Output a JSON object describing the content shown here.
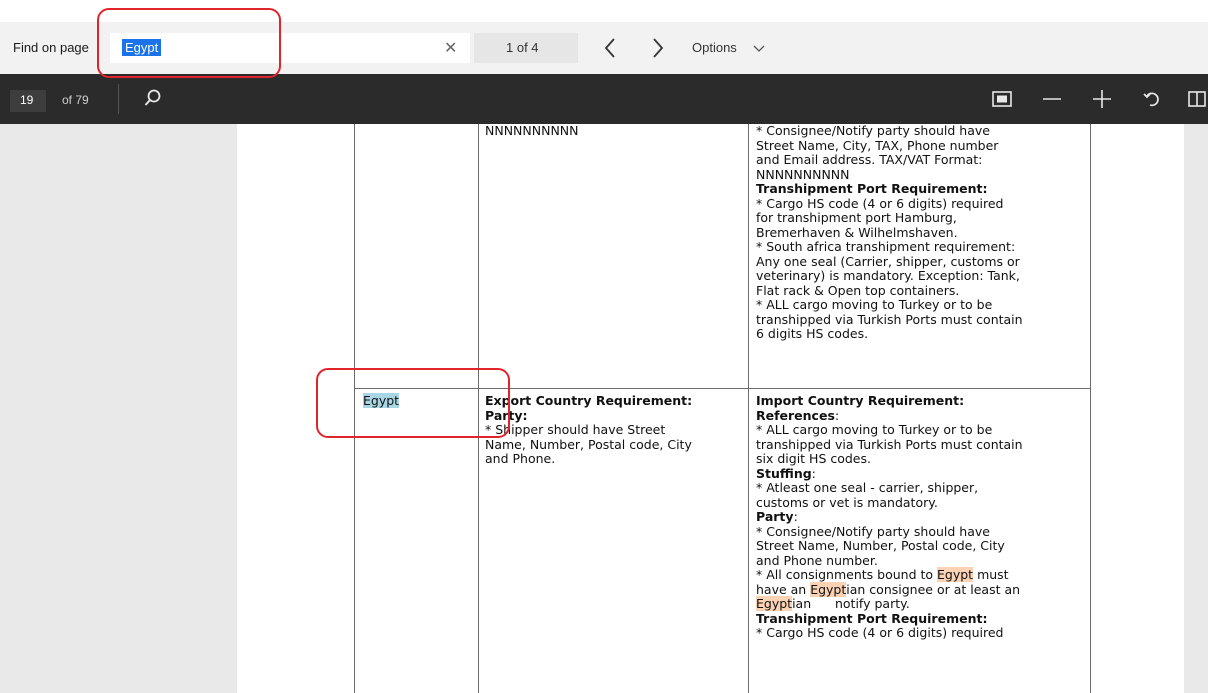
{
  "find_bar": {
    "label": "Find on page",
    "query": "Egypt",
    "clear_icon": "close-icon",
    "match_count": "1 of 4",
    "prev_icon": "chevron-left-icon",
    "next_icon": "chevron-right-icon",
    "options_label": "Options",
    "options_icon": "chevron-down-icon"
  },
  "pdf_toolbar": {
    "page_number": "19",
    "page_total": "of 79",
    "icons": [
      "search-icon",
      "fit-page-icon",
      "zoom-out-icon",
      "zoom-in-icon",
      "rotate-icon",
      "two-page-icon"
    ]
  },
  "document": {
    "top_row": {
      "export_cell_lines": [
        "NNNNNNNNNN"
      ],
      "import_cell_lines": [
        "* Consignee/Notify party should have",
        "Street Name, City, TAX, Phone number",
        "and Email address. TAX/VAT Format:",
        "NNNNNNNNNN",
        "Transhipment Port Requirement:",
        "* Cargo HS code (4 or 6 digits) required",
        "for transhipment port Hamburg,",
        "Bremerhaven & Wilhelmshaven.",
        "* South africa transhipment requirement:",
        "Any one seal (Carrier, shipper, customs or",
        "veterinary) is mandatory. Exception: Tank,",
        "Flat rack & Open top containers.",
        "* ALL cargo moving to Turkey or to be",
        "transhipped via Turkish Ports must contain",
        "6 digits HS codes."
      ]
    },
    "egypt_row": {
      "country": "Egypt",
      "export_heading": "Export Country Requirement:",
      "export_party_label": "Party:",
      "export_lines": [
        "* Shipper should have Street",
        "Name, Number, Postal code, City",
        "and Phone."
      ],
      "import_heading": "Import Country Requirement:",
      "references_label": "References",
      "references_lines": [
        "* ALL cargo moving to Turkey or to be",
        "transhipped via Turkish Ports must contain",
        "six digit HS codes."
      ],
      "stuffing_label": "Stuffing",
      "stuffing_lines": [
        "* Atleast one seal - carrier, shipper,",
        "customs or vet is mandatory."
      ],
      "party_label": "Party",
      "party_lines": [
        "* Consignee/Notify party should have",
        "Street Name, Number, Postal code, City",
        "and Phone number."
      ],
      "consign_line1_pre": "* All consignments bound to ",
      "consign_line1_hl": "Egypt",
      "consign_line1_post": " must",
      "consign_line2_pre": "have an ",
      "consign_line2_hl": "Egypt",
      "consign_line2_post": "ian consignee or at least an",
      "consign_line3_hl": "Egypt",
      "consign_line3_post": "ian      notify party.",
      "transhipment_label": "Transhipment Port Requirement:",
      "transhipment_lines": [
        "* Cargo HS code (4 or 6 digits) required"
      ]
    }
  },
  "colors": {
    "find_bar_bg": "#f2f2f2",
    "pdf_toolbar_bg": "#2b2b2b",
    "selection_blue": "#1a73e8",
    "current_match": "#a9d6e5",
    "other_match": "#fbd3b4",
    "annotation_red": "#e0242b"
  }
}
